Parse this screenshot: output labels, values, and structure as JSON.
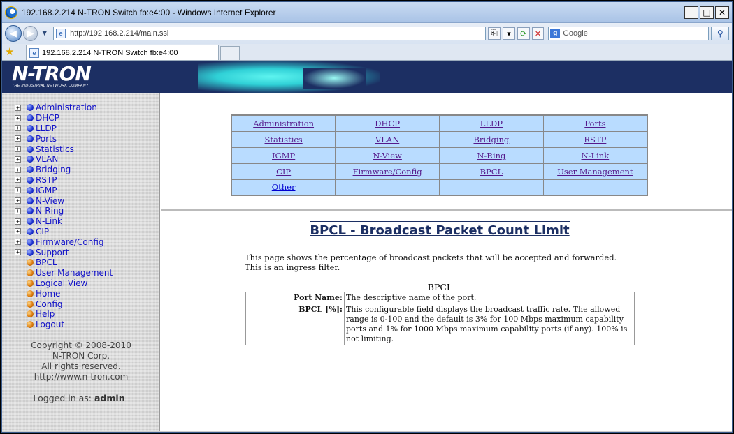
{
  "window": {
    "title": "192.168.2.214 N-TRON Switch fb:e4:00 - Windows Internet Explorer",
    "min": "_",
    "max": "□",
    "close": "✕"
  },
  "addressbar": {
    "url": "http://192.168.2.214/main.ssi",
    "search_placeholder": "Google"
  },
  "tabs": [
    {
      "label": "192.168.2.214 N-TRON Switch fb:e4:00"
    }
  ],
  "banner": {
    "logo": "N-TRON",
    "tagline": "THE INDUSTRIAL NETWORK COMPANY"
  },
  "sidebar": {
    "items": [
      {
        "label": "Administration",
        "type": "folder"
      },
      {
        "label": "DHCP",
        "type": "folder"
      },
      {
        "label": "LLDP",
        "type": "folder"
      },
      {
        "label": "Ports",
        "type": "folder"
      },
      {
        "label": "Statistics",
        "type": "folder"
      },
      {
        "label": "VLAN",
        "type": "folder"
      },
      {
        "label": "Bridging",
        "type": "folder"
      },
      {
        "label": "RSTP",
        "type": "folder"
      },
      {
        "label": "IGMP",
        "type": "folder"
      },
      {
        "label": "N-View",
        "type": "folder"
      },
      {
        "label": "N-Ring",
        "type": "folder"
      },
      {
        "label": "N-Link",
        "type": "folder"
      },
      {
        "label": "CIP",
        "type": "folder"
      },
      {
        "label": "Firmware/Config",
        "type": "folder"
      },
      {
        "label": "Support",
        "type": "folder"
      },
      {
        "label": "BPCL",
        "type": "page"
      },
      {
        "label": "User Management",
        "type": "page"
      },
      {
        "label": "Logical View",
        "type": "page"
      },
      {
        "label": "Home",
        "type": "page"
      },
      {
        "label": "Config",
        "type": "page"
      },
      {
        "label": "Help",
        "type": "page"
      },
      {
        "label": "Logout",
        "type": "page"
      }
    ],
    "copyright": [
      "Copyright © 2008-2010",
      "N-TRON Corp.",
      "All rights reserved.",
      "http://www.n-tron.com"
    ],
    "logged_in_label": "Logged in as:",
    "logged_in_user": "admin"
  },
  "nav_grid": [
    [
      "Administration",
      "DHCP",
      "LLDP",
      "Ports"
    ],
    [
      "Statistics",
      "VLAN",
      "Bridging",
      "RSTP"
    ],
    [
      "IGMP",
      "N-View",
      "N-Ring",
      "N-Link"
    ],
    [
      "CIP",
      "Firmware/Config",
      "BPCL",
      "User Management"
    ],
    [
      "Other",
      "",
      "",
      ""
    ]
  ],
  "main": {
    "title": "BPCL - Broadcast Packet Count Limit",
    "description": "This page shows the percentage of broadcast packets that will be accepted and forwarded. This is an ingress filter.",
    "table_caption": "BPCL",
    "rows": [
      {
        "label": "Port Name:",
        "text": "The descriptive name of the port."
      },
      {
        "label": "BPCL [%]:",
        "text": "This configurable field displays the broadcast traffic rate. The allowed range is 0-100 and the default is 3% for 100 Mbps maximum capability ports and 1% for 1000 Mbps maximum capability ports (if any). 100% is not limiting."
      }
    ]
  }
}
